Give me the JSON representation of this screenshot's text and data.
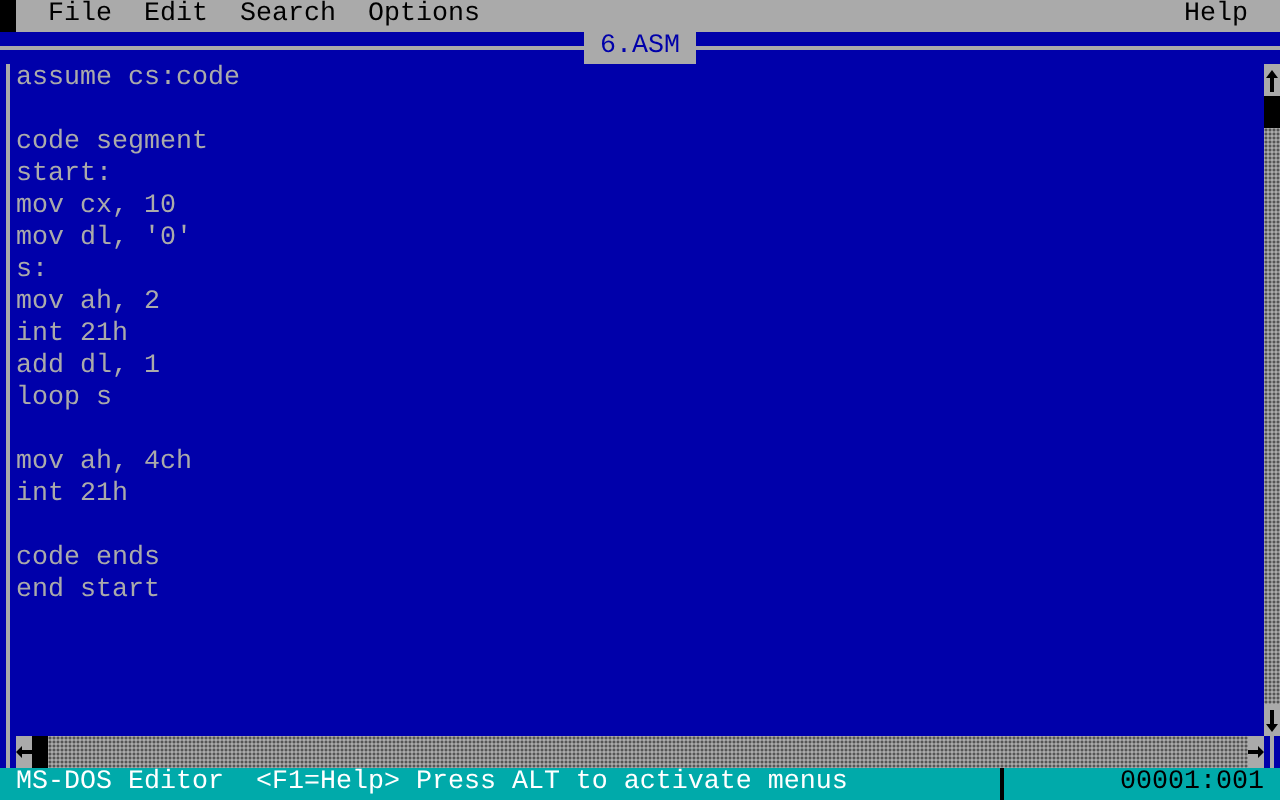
{
  "menu_bar": {
    "items": [
      {
        "label": "File"
      },
      {
        "label": "Edit"
      },
      {
        "label": "Search"
      },
      {
        "label": "Options"
      }
    ],
    "help": "Help"
  },
  "window": {
    "title": "6.ASM"
  },
  "editor": {
    "lines": [
      {
        "kind": "text",
        "text": "assume cs:code"
      },
      {
        "kind": "blank"
      },
      {
        "kind": "text",
        "text": "code segment"
      },
      {
        "kind": "text",
        "text": "start:"
      },
      {
        "kind": "text",
        "text": "mov cx, 10"
      },
      {
        "kind": "text",
        "text": "mov dl, '0'"
      },
      {
        "kind": "text",
        "text": "s:"
      },
      {
        "kind": "text",
        "text": "mov ah, 2"
      },
      {
        "kind": "text",
        "text": "int 21h"
      },
      {
        "kind": "text",
        "text": "add dl, 1"
      },
      {
        "kind": "text",
        "text": "loop s"
      },
      {
        "kind": "blank"
      },
      {
        "kind": "text",
        "text": "mov ah, 4ch"
      },
      {
        "kind": "text",
        "text": "int 21h"
      },
      {
        "kind": "blank"
      },
      {
        "kind": "text",
        "text": "code ends"
      },
      {
        "kind": "text",
        "text": "end start"
      }
    ]
  },
  "status_bar": {
    "message": "MS-DOS Editor  <F1=Help> Press ALT to activate menus",
    "position": "00001:001"
  }
}
